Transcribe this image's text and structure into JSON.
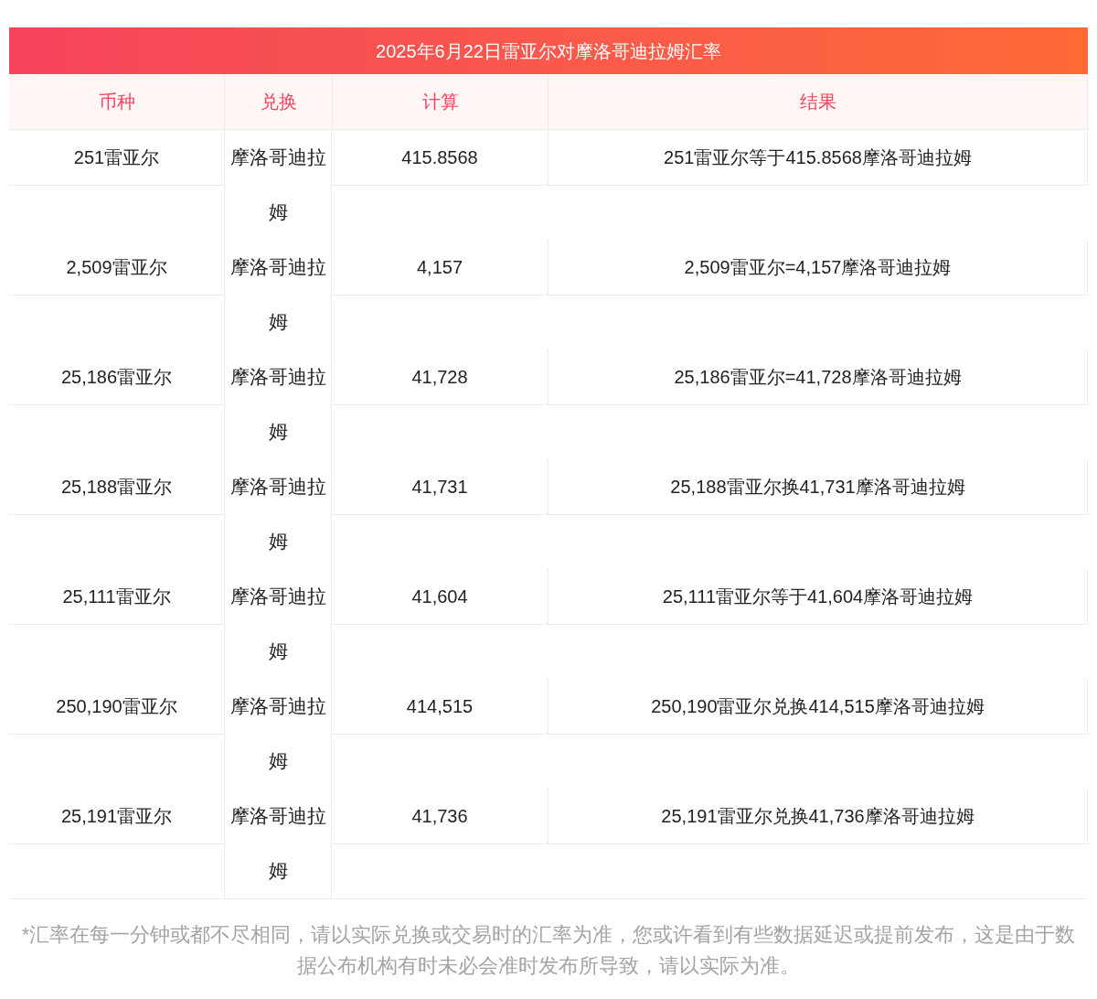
{
  "title": "2025年6月22日雷亚尔对摩洛哥迪拉姆汇率",
  "columns": [
    "币种",
    "兑换",
    "计算",
    "结果"
  ],
  "rows": [
    {
      "currency": "251雷亚尔",
      "target": "摩洛哥迪拉姆",
      "amount": "415.8568",
      "result": "251雷亚尔等于415.8568摩洛哥迪拉姆"
    },
    {
      "currency": "2,509雷亚尔",
      "target": "摩洛哥迪拉姆",
      "amount": "4,157",
      "result": "2,509雷亚尔=4,157摩洛哥迪拉姆"
    },
    {
      "currency": "25,186雷亚尔",
      "target": "摩洛哥迪拉姆",
      "amount": "41,728",
      "result": "25,186雷亚尔=41,728摩洛哥迪拉姆"
    },
    {
      "currency": "25,188雷亚尔",
      "target": "摩洛哥迪拉姆",
      "amount": "41,731",
      "result": "25,188雷亚尔换41,731摩洛哥迪拉姆"
    },
    {
      "currency": "25,111雷亚尔",
      "target": "摩洛哥迪拉姆",
      "amount": "41,604",
      "result": "25,111雷亚尔等于41,604摩洛哥迪拉姆"
    },
    {
      "currency": "250,190雷亚尔",
      "target": "摩洛哥迪拉姆",
      "amount": "414,515",
      "result": "250,190雷亚尔兑换414,515摩洛哥迪拉姆"
    },
    {
      "currency": "25,191雷亚尔",
      "target": "摩洛哥迪拉姆",
      "amount": "41,736",
      "result": "25,191雷亚尔兑换41,736摩洛哥迪拉姆"
    }
  ],
  "footnote": "*汇率在每一分钟或都不尽相同，请以实际兑换或交易时的汇率为准，您或许看到有些数据延迟或提前发布，这是由于数据公布机构有时未必会准时发布所导致，请以实际为准。"
}
